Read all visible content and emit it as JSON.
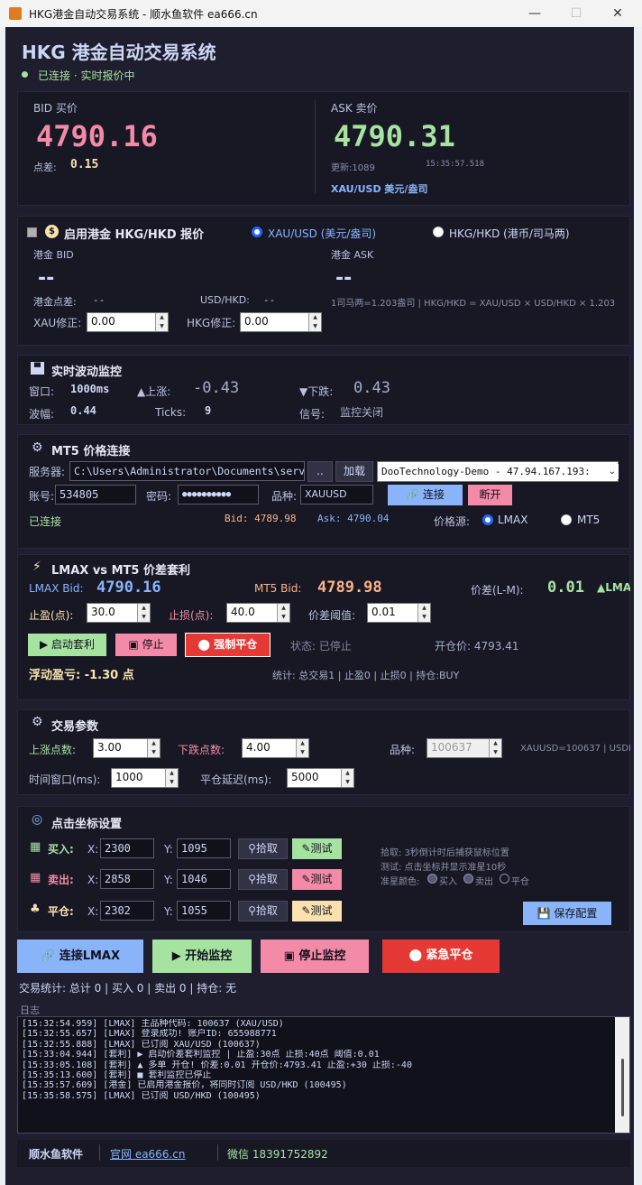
{
  "window": {
    "title": "HKG港金自动交易系统 - 顺水鱼软件 ea666.cn",
    "min": "—",
    "max": "☐",
    "close": "✕"
  },
  "header": {
    "title": "HKG 港金自动交易系统",
    "status": "已连接 · 实时报价中"
  },
  "quote": {
    "bid_label": "BID 买价",
    "bid": "4790.16",
    "spread_label": "点差:",
    "spread": "0.15",
    "ask_label": "ASK 卖价",
    "ask": "4790.31",
    "updates": "更新:1089",
    "time": "15:35:57.518",
    "symbol": "XAU/USD 美元/盎司"
  },
  "hkg": {
    "enable_label": "启用港金 HKG/HKD 报价",
    "radio1": "XAU/USD (美元/盎司)",
    "radio2": "HKG/HKD (港币/司马两)",
    "bid_label": "港金 BID",
    "bid": "--",
    "ask_label": "港金 ASK",
    "ask": "--",
    "spread_label": "港金点差:",
    "spread": "--",
    "usdhkd_label": "USD/HKD:",
    "usdhkd": "--",
    "formula": "1司马两=1.203盎司 | HKG/HKD = XAU/USD × USD/HKD × 1.203",
    "xau_adj_label": "XAU修正:",
    "xau_adj": "0.00",
    "hkg_adj_label": "HKG修正:",
    "hkg_adj": "0.00"
  },
  "monitor": {
    "title": "实时波动监控",
    "window_label": "窗口:",
    "window": "1000ms",
    "up_label": "▲上涨:",
    "up": "-0.43",
    "down_label": "▼下跌:",
    "down": "0.43",
    "amp_label": "波幅:",
    "amp": "0.44",
    "ticks_label": "Ticks:",
    "ticks": "9",
    "signal_label": "信号:",
    "signal": "监控关闭"
  },
  "mt5": {
    "title": "MT5 价格连接",
    "server_label": "服务器:",
    "server_path": "C:\\Users\\Administrator\\Documents\\serv",
    "browse": "..",
    "load": "加载",
    "server_select": "DooTechnology-Demo - 47.94.167.193:",
    "account_label": "账号:",
    "account": "534805",
    "password_label": "密码:",
    "password": "●●●●●●●●●●",
    "symbol_label": "品种:",
    "symbol": "XAUUSD",
    "connect": "连接",
    "disconnect": "断开",
    "status": "已连接",
    "bid": "Bid: 4789.98",
    "ask": "Ask: 4790.04",
    "source_label": "价格源:",
    "source1": "LMAX",
    "source2": "MT5"
  },
  "arb": {
    "title": "LMAX vs MT5 价差套利",
    "lmax_label": "LMAX Bid:",
    "lmax_bid": "4790.16",
    "mt5_label": "MT5 Bid:",
    "mt5_bid": "4789.98",
    "diff_label": "价差(L-M):",
    "diff": "0.01",
    "diff_flag": "▲LMA",
    "tp_label": "止盈(点):",
    "tp": "30.0",
    "sl_label": "止损(点):",
    "sl": "40.0",
    "threshold_label": "价差阈值:",
    "threshold": "0.01",
    "start": "启动套利",
    "stop": "停止",
    "force_close": "强制平仓",
    "state": "状态: 已停止",
    "open_price": "开仓价: 4793.41",
    "pnl": "浮动盈亏: -1.30 点",
    "stats": "统计: 总交易1 | 止盈0 | 止损0 | 持仓:BUY"
  },
  "params": {
    "title": "交易参数",
    "up_label": "上涨点数:",
    "up": "3.00",
    "down_label": "下跌点数:",
    "down": "4.00",
    "symbol_label": "品种:",
    "symbol": "100637",
    "symbol_note": "XAUUSD=100637 | USDH",
    "window_label": "时间窗口(ms):",
    "window": "1000",
    "delay_label": "平仓延迟(ms):",
    "delay": "5000"
  },
  "coords": {
    "title": "点击坐标设置",
    "buy_label": "买入:",
    "buy_x": "2300",
    "buy_y": "1095",
    "sell_label": "卖出:",
    "sell_x": "2858",
    "sell_y": "1046",
    "close_label": "平仓:",
    "close_x": "2302",
    "close_y": "1055",
    "x_label": "X:",
    "y_label": "Y:",
    "pick": "拾取",
    "test": "测试",
    "help1": "拾取: 3秒倒计时后捕获鼠标位置",
    "help2": "测试: 点击坐标并显示准星10秒",
    "help3_label": "准星颜色:",
    "c_buy": "买入",
    "c_sell": "卖出",
    "c_close": "平仓",
    "save": "保存配置"
  },
  "actions": {
    "connect": "连接LMAX",
    "start": "开始监控",
    "stop": "停止监控",
    "emergency": "紧急平仓"
  },
  "trade_stats": "交易统计: 总计 0 | 买入 0 | 卖出 0 | 持仓: 无",
  "log": {
    "title": "日志",
    "lines": [
      "[15:32:54.959] [LMAX] 主品种代码: 100637 (XAU/USD)",
      "[15:32:55.657] [LMAX] 登录成功! 账户ID: 655988771",
      "[15:32:55.888] [LMAX] 已订阅 XAU/USD (100637)",
      "[15:33:04.944] [套利] ▶ 启动价差套利监控 | 止盈:30点 止损:40点 阈值:0.01",
      "[15:33:05.108] [套利] ▲ 多单 开仓! 价差:0.01 开仓价:4793.41 止盈:+30 止损:-40",
      "[15:35:13.600] [套利] ■ 套利监控已停止",
      "[15:35:57.609] [港金] 已启用港金报价，将同时订阅 USD/HKD (100495)",
      "[15:35:58.575] [LMAX] 已订阅 USD/HKD (100495)"
    ]
  },
  "footer": {
    "brand": "顺水鱼软件",
    "site": "官网 ea666.cn",
    "wechat": "微信 18391752892"
  },
  "colors": {
    "bid": "#f38ba8",
    "ask": "#a6e3a1",
    "accent": "#89b4fa",
    "yellow": "#f9e2af"
  }
}
